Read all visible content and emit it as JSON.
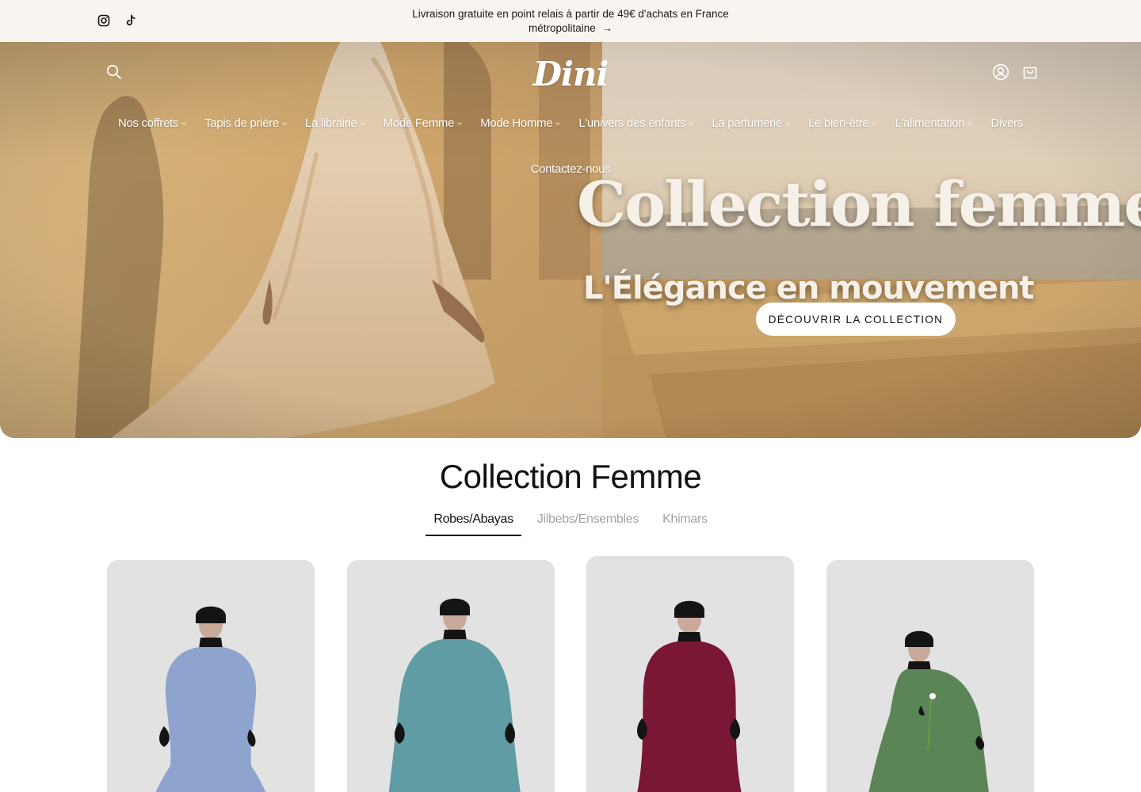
{
  "announcement": {
    "text": "Livraison gratuite en point relais à partir de 49€ d'achats en France métropolitaine",
    "arrow": "→",
    "social_icons": [
      "instagram-icon",
      "tiktok-icon"
    ]
  },
  "header": {
    "logo": "Dini",
    "icons": [
      "search-icon",
      "account-icon",
      "cart-icon"
    ]
  },
  "nav": {
    "items": [
      {
        "label": "Nos coffrets",
        "dropdown": true
      },
      {
        "label": "Tapis de prière",
        "dropdown": true
      },
      {
        "label": "La librairie",
        "dropdown": true
      },
      {
        "label": "Mode Femme",
        "dropdown": true
      },
      {
        "label": "Mode Homme",
        "dropdown": true
      },
      {
        "label": "L'univers des enfants",
        "dropdown": true
      },
      {
        "label": "La parfumerie",
        "dropdown": true
      },
      {
        "label": "Le bien-être",
        "dropdown": true
      },
      {
        "label": "L'alimentation",
        "dropdown": true
      },
      {
        "label": "Divers",
        "dropdown": false
      },
      {
        "label": "Contactez-nous",
        "dropdown": false
      }
    ]
  },
  "hero": {
    "title": "Collection femme",
    "subtitle": "L'Élégance en mouvement",
    "cta": "DÉCOUVRIR LA COLLECTION"
  },
  "collection": {
    "title": "Collection Femme",
    "tabs": [
      {
        "label": "Robes/Abayas",
        "active": true
      },
      {
        "label": "Jilbebs/Ensembles",
        "active": false
      },
      {
        "label": "Khimars",
        "active": false
      }
    ],
    "products": [
      {
        "color": "#8ea4cf"
      },
      {
        "color": "#5f9ca4"
      },
      {
        "color": "#7a1734"
      },
      {
        "color": "#5b8457"
      }
    ]
  },
  "colors": {
    "announcement_bg": "#f8f4ef",
    "text": "#121212",
    "muted_tab": "#a3a3a3",
    "hero_title": "#f6f1e8"
  }
}
